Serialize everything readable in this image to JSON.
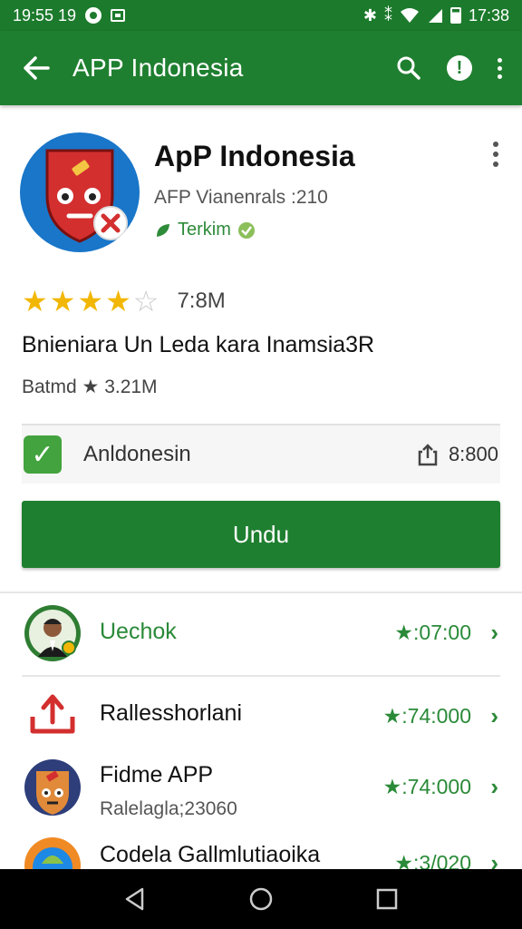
{
  "status_bar": {
    "left_time": "19:55 19",
    "right_time": "17:38"
  },
  "toolbar": {
    "title": "APP Indonesia"
  },
  "app": {
    "name": "ApP Indonesia",
    "developer": "AFP Vianenrals :210",
    "badge": "Terkim"
  },
  "rating": {
    "stars_filled": 4,
    "stars_total": 5,
    "count": "7:8M"
  },
  "tagline": "Bnieniara Un Leda kara Inamsia3R",
  "meta": "Batmd ★ 3.21M",
  "info_row": {
    "label": "Anldonesin",
    "value": "8:800"
  },
  "install_button": {
    "label": "Undu"
  },
  "list": [
    {
      "title": "Uechok",
      "subtitle": "",
      "price": "★:07:00",
      "title_color": "#2a8a38"
    },
    {
      "title": "Rallesshorlani",
      "subtitle": "",
      "price": "★:74:000",
      "title_color": "#111111"
    },
    {
      "title": "Fidme APP",
      "subtitle": "Ralelagla;23060",
      "price": "★:74:000",
      "title_color": "#111111"
    },
    {
      "title": "Codela Gallmlutiaoika",
      "subtitle": "",
      "price": "★:3/020",
      "title_color": "#111111"
    }
  ],
  "colors": {
    "primary": "#1f7f30",
    "accent_green": "#2a8a38",
    "star": "#f2b705"
  }
}
